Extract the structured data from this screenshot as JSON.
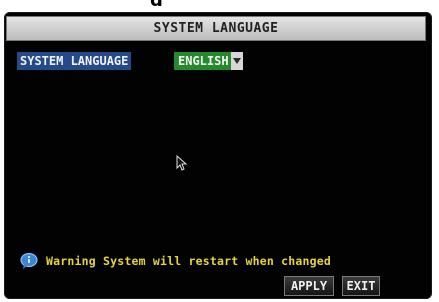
{
  "header_fragment": "g",
  "window": {
    "title": "SYSTEM LANGUAGE"
  },
  "settings": {
    "language_label": "SYSTEM LANGUAGE",
    "language_value": "ENGLISH"
  },
  "warning": {
    "icon": "info-icon",
    "text": "Warning System will restart when changed"
  },
  "buttons": {
    "apply_label": "APPLY",
    "exit_label": "EXIT"
  },
  "colors": {
    "screen_bg": "#020202",
    "label_highlight": "#244a8c",
    "select_highlight": "#248a2c",
    "warning_text": "#e8d43a"
  }
}
